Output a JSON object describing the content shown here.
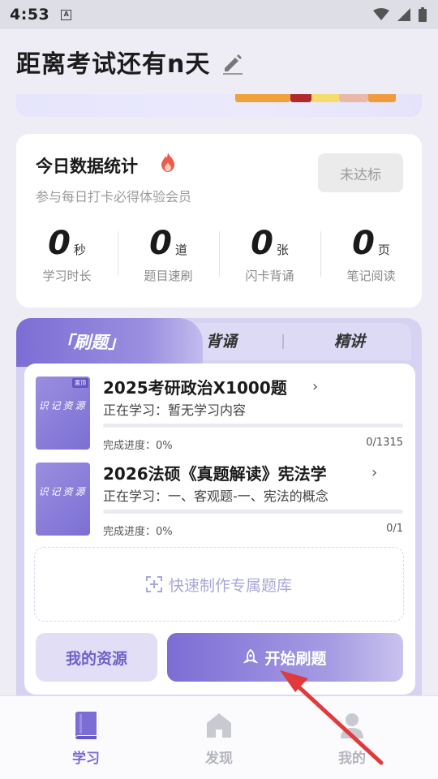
{
  "status_bar": {
    "time": "4:53",
    "notification_letter": "A"
  },
  "header": {
    "title": "距离考试还有n天"
  },
  "stats": {
    "title": "今日数据统计",
    "subtitle": "参与每日打卡必得体验会员",
    "status_button": "未达标",
    "items": [
      {
        "value": "0",
        "unit": "秒",
        "label": "学习时长"
      },
      {
        "value": "0",
        "unit": "道",
        "label": "题目速刷"
      },
      {
        "value": "0",
        "unit": "张",
        "label": "闪卡背诵"
      },
      {
        "value": "0",
        "unit": "页",
        "label": "笔记阅读"
      }
    ]
  },
  "tabs": [
    {
      "label": "「刷题」",
      "active": true
    },
    {
      "label": "背诵",
      "active": false
    },
    {
      "label": "精讲",
      "active": false
    }
  ],
  "courses": [
    {
      "cover_text": "识记资源",
      "badge": "置顶",
      "title": "2025考研政治X1000题",
      "studying": "正在学习：暂无学习内容",
      "progress_label": "完成进度：0%",
      "progress": 0,
      "count": "0/1315"
    },
    {
      "cover_text": "识记资源",
      "title": "2026法硕《真题解读》宪法学",
      "studying": "正在学习：一、客观题-一、宪法的概念",
      "progress_label": "完成进度：0%",
      "progress": 0,
      "count": "0/1"
    }
  ],
  "quick_create": "快速制作专属题库",
  "my_resources_button": "我的资源",
  "start_button": "开始刷题",
  "bottom_nav": [
    {
      "label": "学习",
      "icon": "book-icon",
      "active": true
    },
    {
      "label": "发现",
      "icon": "home-icon",
      "active": false
    },
    {
      "label": "我的",
      "icon": "person-icon",
      "active": false
    }
  ],
  "colors": {
    "accent": "#7c6dd5",
    "annotation_arrow": "#e03a3a"
  }
}
